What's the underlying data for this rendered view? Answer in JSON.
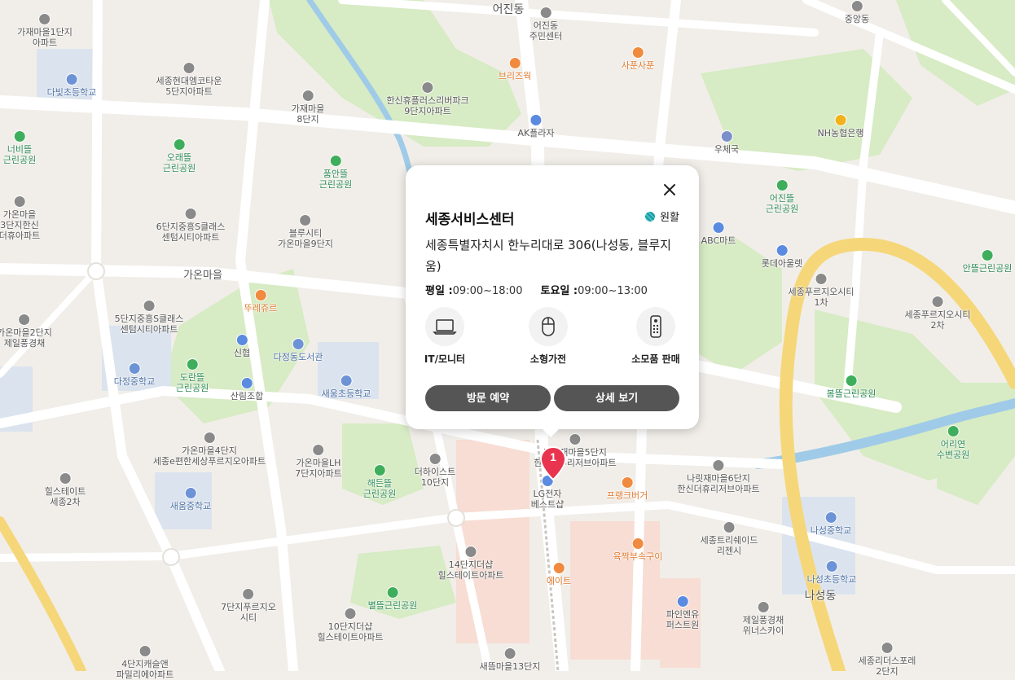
{
  "map": {
    "districts": [
      "어진동",
      "나성동"
    ],
    "road_names": [
      "가온마을"
    ],
    "places": [
      {
        "kind": "apt",
        "name": "가재마을1단지\n아파트"
      },
      {
        "kind": "school",
        "name": "다빛초등학교"
      },
      {
        "kind": "apt",
        "name": "세종현대엠코타운\n5단지아파트"
      },
      {
        "kind": "apt",
        "name": "가재마을\n8단지"
      },
      {
        "kind": "apt",
        "name": "한신휴플러스리버파크\n9단지아파트"
      },
      {
        "kind": "apt",
        "name": "어진동\n주민센터"
      },
      {
        "kind": "food",
        "name": "브리즈웍"
      },
      {
        "kind": "food",
        "name": "사푼사푼"
      },
      {
        "kind": "shop",
        "name": "AK플라자"
      },
      {
        "kind": "post",
        "name": "우체국"
      },
      {
        "kind": "bank",
        "name": "NH농협은행"
      },
      {
        "kind": "park",
        "name": "너비뜰\n근린공원"
      },
      {
        "kind": "park",
        "name": "오래뜰\n근린공원"
      },
      {
        "kind": "park",
        "name": "품안뜰\n근린공원"
      },
      {
        "kind": "park",
        "name": "어진뜰\n근린공원"
      },
      {
        "kind": "apt",
        "name": "가온마을\n3단지한신\n더휴아파트"
      },
      {
        "kind": "apt",
        "name": "6단지중흥S클래스\n센텀시티아파트"
      },
      {
        "kind": "apt",
        "name": "블루시티\n가온마을9단지"
      },
      {
        "kind": "shop",
        "name": "ABC마트"
      },
      {
        "kind": "shop",
        "name": "롯데아울렛"
      },
      {
        "kind": "apt",
        "name": "세종푸르지오시티\n1차"
      },
      {
        "kind": "park",
        "name": "안뜰근린공원"
      },
      {
        "kind": "food",
        "name": "뚜레쥬르"
      },
      {
        "kind": "apt",
        "name": "5단지중흥S클래스\n센텀시티아파트"
      },
      {
        "kind": "apt",
        "name": "가온마을2단지\n제일풍경채"
      },
      {
        "kind": "shop",
        "name": "신협"
      },
      {
        "kind": "school",
        "name": "다정동도서관"
      },
      {
        "kind": "apt",
        "name": "세종푸르지오시티\n2차"
      },
      {
        "kind": "school",
        "name": "다정중학교"
      },
      {
        "kind": "park",
        "name": "도란뜰\n근린공원"
      },
      {
        "kind": "shop",
        "name": "산림조합"
      },
      {
        "kind": "school",
        "name": "새움초등학교"
      },
      {
        "kind": "park",
        "name": "봄뜰근린공원"
      },
      {
        "kind": "park",
        "name": "어리연\n수변공원"
      },
      {
        "kind": "apt",
        "name": "가온마을4단지\n세종e편한세상푸르지오아파트"
      },
      {
        "kind": "apt",
        "name": "가온마을LH\n7단지아파트"
      },
      {
        "kind": "park",
        "name": "해든뜰\n근린공원"
      },
      {
        "kind": "apt",
        "name": "더하이스트\n10단지"
      },
      {
        "kind": "apt",
        "name": "나릿재마을5단지\n한신더휴리저브아파트"
      },
      {
        "kind": "shop",
        "name": "LG전자\n베스트샵"
      },
      {
        "kind": "food",
        "name": "프랭크버거"
      },
      {
        "kind": "apt",
        "name": "나릿재마을6단지\n한신더휴리저브아파트"
      },
      {
        "kind": "apt",
        "name": "힐스테이트\n세종2차"
      },
      {
        "kind": "school",
        "name": "새움중학교"
      },
      {
        "kind": "school",
        "name": "나성중학교"
      },
      {
        "kind": "apt",
        "name": "세종트리쉐이드\n리젠시"
      },
      {
        "kind": "food",
        "name": "육짝부속구이"
      },
      {
        "kind": "apt",
        "name": "14단지더샵\n힐스테이트아파트"
      },
      {
        "kind": "food",
        "name": "에이트"
      },
      {
        "kind": "school",
        "name": "나성초등학교"
      },
      {
        "kind": "park",
        "name": "별뜰근린공원"
      },
      {
        "kind": "apt",
        "name": "7단지푸르지오\n시티"
      },
      {
        "kind": "apt",
        "name": "10단지더샵\n힐스테이트아파트"
      },
      {
        "kind": "shop",
        "name": "파인엔유\n퍼스트원"
      },
      {
        "kind": "apt",
        "name": "제일풍경채\n위너스카이"
      },
      {
        "kind": "apt",
        "name": "4단지캐슬앤\n파밀리에아파트"
      },
      {
        "kind": "apt",
        "name": "새뜸마을13단지"
      },
      {
        "kind": "apt",
        "name": "세종리더스포레\n2단지"
      },
      {
        "kind": "apt",
        "name": "중앙동"
      }
    ]
  },
  "marker": {
    "number": "1",
    "color": "#e8344e"
  },
  "popup": {
    "title": "세종서비스센터",
    "status": "원활",
    "status_color": "#1a9aa0",
    "address": "세종특별자치시 한누리대로 306(나성동, 블루지움)",
    "weekday_label": "평일 :",
    "weekday_hours": "09:00~18:00",
    "saturday_label": "토요일 :",
    "saturday_hours": "09:00~13:00",
    "services": [
      {
        "label": "IT/모니터",
        "icon": "laptop-icon"
      },
      {
        "label": "소형가전",
        "icon": "mouse-icon"
      },
      {
        "label": "소모품 판매",
        "icon": "remote-icon"
      }
    ],
    "buttons": {
      "reserve": "방문 예약",
      "details": "상세 보기"
    },
    "button_color": "#555555"
  }
}
